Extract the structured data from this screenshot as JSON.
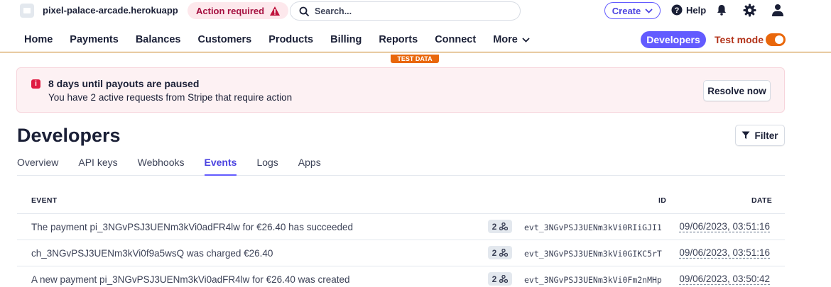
{
  "topbar": {
    "account_name": "pixel-palace-arcade.herokuapp",
    "action_required": "Action required",
    "search_placeholder": "Search...",
    "create_label": "Create",
    "help_label": "Help",
    "icons": [
      "account-icon",
      "warning-icon",
      "search-icon",
      "chevron-down-icon",
      "help-icon",
      "bell-icon",
      "gear-icon",
      "user-icon"
    ]
  },
  "nav": {
    "items": [
      "Home",
      "Payments",
      "Balances",
      "Customers",
      "Products",
      "Billing",
      "Reports",
      "Connect",
      "More"
    ],
    "developers_label": "Developers",
    "test_mode_label": "Test mode",
    "test_mode_on": true,
    "test_data_tag": "TEST DATA"
  },
  "banner": {
    "title": "8 days until payouts are paused",
    "subtitle": "You have 2 active requests from Stripe that require action",
    "resolve_label": "Resolve now"
  },
  "page": {
    "title": "Developers",
    "filter_label": "Filter"
  },
  "tabs": {
    "items": [
      "Overview",
      "API keys",
      "Webhooks",
      "Events",
      "Logs",
      "Apps"
    ],
    "active": "Events"
  },
  "table": {
    "columns": [
      "EVENT",
      "ID",
      "DATE"
    ],
    "rows": [
      {
        "event": "The payment pi_3NGvPSJ3UENm3kVi0adFR4lw for €26.40 has succeeded",
        "webhooks": "2",
        "id": "evt_3NGvPSJ3UENm3kVi0RIiGJI1",
        "date": "09/06/2023, 03:51:16"
      },
      {
        "event": "ch_3NGvPSJ3UENm3kVi0f9a5wsQ was charged €26.40",
        "webhooks": "2",
        "id": "evt_3NGvPSJ3UENm3kVi0GIKC5rT",
        "date": "09/06/2023, 03:51:16"
      },
      {
        "event": "A new payment pi_3NGvPSJ3UENm3kVi0adFR4lw for €26.40 was created",
        "webhooks": "2",
        "id": "evt_3NGvPSJ3UENm3kVi0Fm2nMHp",
        "date": "09/06/2023, 03:50:42"
      }
    ]
  },
  "colors": {
    "accent": "#635bff",
    "test_orange": "#e9670b",
    "danger": "#df1b41"
  }
}
